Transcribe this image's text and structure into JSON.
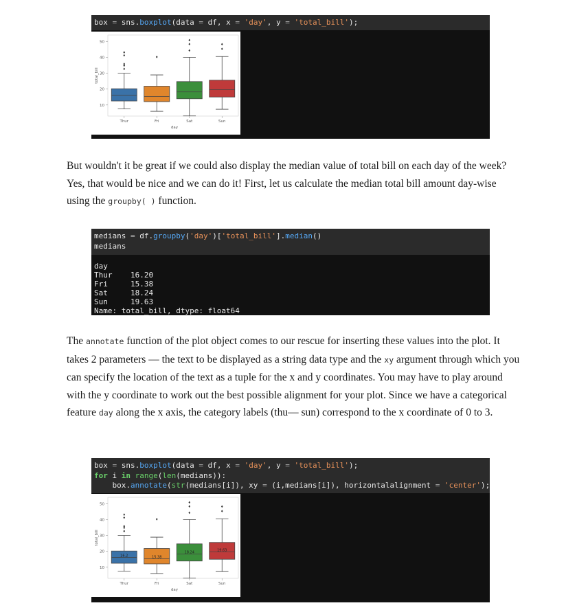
{
  "colors": {
    "thur": "#3a72a8",
    "fri": "#e0862c",
    "sat": "#3b8f3b",
    "sun": "#bf3a3a",
    "code_bg": "#111111",
    "code_header_bg": "#2b2b2b"
  },
  "block1": {
    "code_tokens": [
      [
        "box ",
        "k-var"
      ],
      [
        "=",
        "k-op"
      ],
      [
        " sns.",
        "k-var"
      ],
      [
        "boxplot",
        "k-fn"
      ],
      [
        "(data ",
        "k-var"
      ],
      [
        "=",
        "k-op"
      ],
      [
        " df, x ",
        "k-var"
      ],
      [
        "=",
        "k-op"
      ],
      [
        " ",
        "k-var"
      ],
      [
        "'day'",
        "k-str"
      ],
      [
        ", y ",
        "k-var"
      ],
      [
        "=",
        "k-op"
      ],
      [
        " ",
        "k-var"
      ],
      [
        "'total_bill'",
        "k-str"
      ],
      [
        ");",
        "k-var"
      ]
    ]
  },
  "para1": {
    "before": "But wouldn't it be great if we could also display the median value of total bill on each day of the week? Yes, that would be nice and we can do it! First, let us calculate the median total bill amount day-wise using the ",
    "code": "groupby( )",
    "after": " function."
  },
  "block2": {
    "line1": [
      [
        "medians ",
        "k-var"
      ],
      [
        "=",
        "k-op"
      ],
      [
        " df.",
        "k-var"
      ],
      [
        "groupby",
        "k-fn"
      ],
      [
        "(",
        "k-var"
      ],
      [
        "'day'",
        "k-str"
      ],
      [
        ")[",
        "k-var"
      ],
      [
        "'total_bill'",
        "k-str"
      ],
      [
        "].",
        "k-var"
      ],
      [
        "median",
        "k-fn"
      ],
      [
        "()",
        "k-var"
      ]
    ],
    "line2": "medians",
    "output": [
      "day",
      "Thur    16.20",
      "Fri     15.38",
      "Sat     18.24",
      "Sun     19.63",
      "Name: total_bill, dtype: float64"
    ]
  },
  "para2": {
    "segments": [
      [
        "The ",
        "t"
      ],
      [
        "annotate",
        "c"
      ],
      [
        " function of the plot object comes to our rescue for inserting these values into the plot. It takes 2 parameters — the text to be displayed as a string data type and the ",
        "t"
      ],
      [
        "xy",
        "c"
      ],
      [
        " argument through which you can specify the location of the text as a tuple for the x and y coordinates. You may have to play around with the y coordinate to work out the best possible alignment for your plot. Since we have a categorical feature ",
        "t"
      ],
      [
        "day",
        "c"
      ],
      [
        " along the x axis, the category labels (thu— sun) correspond to the x coordinate of 0 to 3.",
        "t"
      ]
    ]
  },
  "block3": {
    "lines": [
      [
        [
          "box ",
          "k-var"
        ],
        [
          "=",
          "k-op"
        ],
        [
          " sns.",
          "k-var"
        ],
        [
          "boxplot",
          "k-fn"
        ],
        [
          "(data ",
          "k-var"
        ],
        [
          "=",
          "k-op"
        ],
        [
          " df, x ",
          "k-var"
        ],
        [
          "=",
          "k-op"
        ],
        [
          " ",
          "k-var"
        ],
        [
          "'day'",
          "k-str"
        ],
        [
          ", y ",
          "k-var"
        ],
        [
          "=",
          "k-op"
        ],
        [
          " ",
          "k-var"
        ],
        [
          "'total_bill'",
          "k-str"
        ],
        [
          ");",
          "k-var"
        ]
      ],
      [
        [
          "for",
          "k-kw"
        ],
        [
          " i ",
          "k-var"
        ],
        [
          "in",
          "k-kw"
        ],
        [
          " ",
          "k-var"
        ],
        [
          "range",
          "k-blt"
        ],
        [
          "(",
          "k-var"
        ],
        [
          "len",
          "k-blt"
        ],
        [
          "(medians)):",
          "k-var"
        ]
      ],
      [
        [
          "    box.",
          "k-var"
        ],
        [
          "annotate",
          "k-fn"
        ],
        [
          "(",
          "k-var"
        ],
        [
          "str",
          "k-blt"
        ],
        [
          "(medians[i]), xy ",
          "k-var"
        ],
        [
          "=",
          "k-op"
        ],
        [
          " (i,medians[i]), horizontalalignment ",
          "k-var"
        ],
        [
          "=",
          "k-op"
        ],
        [
          " ",
          "k-var"
        ],
        [
          "'center'",
          "k-str"
        ],
        [
          ");",
          "k-var"
        ]
      ]
    ]
  },
  "chart_data": [
    {
      "type": "box",
      "xlabel": "day",
      "ylabel": "total_bill",
      "categories": [
        "Thur",
        "Fri",
        "Sat",
        "Sun"
      ],
      "ylim": [
        3,
        54
      ],
      "yticks": [
        10,
        20,
        30,
        40,
        50
      ],
      "boxes": [
        {
          "whisker_low": 7.5,
          "q1": 12.5,
          "median": 16.2,
          "q3": 20.2,
          "whisker_high": 30.0,
          "outliers": [
            32.7,
            34.8,
            35.8,
            41.2,
            43.1
          ]
        },
        {
          "whisker_low": 6.0,
          "q1": 12.1,
          "median": 15.38,
          "q3": 21.8,
          "whisker_high": 28.9,
          "outliers": [
            40.2
          ]
        },
        {
          "whisker_low": 3.1,
          "q1": 13.9,
          "median": 18.24,
          "q3": 24.7,
          "whisker_high": 40.0,
          "outliers": [
            44.3,
            48.3,
            50.8
          ]
        },
        {
          "whisker_low": 7.3,
          "q1": 15.0,
          "median": 19.63,
          "q3": 25.6,
          "whisker_high": 40.5,
          "outliers": [
            45.3,
            48.2
          ]
        }
      ],
      "annotations": []
    },
    {
      "type": "box",
      "xlabel": "day",
      "ylabel": "total_bill",
      "categories": [
        "Thur",
        "Fri",
        "Sat",
        "Sun"
      ],
      "ylim": [
        3,
        54
      ],
      "yticks": [
        10,
        20,
        30,
        40,
        50
      ],
      "boxes": [
        {
          "whisker_low": 7.5,
          "q1": 12.5,
          "median": 16.2,
          "q3": 20.2,
          "whisker_high": 30.0,
          "outliers": [
            32.7,
            34.8,
            35.8,
            41.2,
            43.1
          ]
        },
        {
          "whisker_low": 6.0,
          "q1": 12.1,
          "median": 15.38,
          "q3": 21.8,
          "whisker_high": 28.9,
          "outliers": [
            40.2
          ]
        },
        {
          "whisker_low": 3.1,
          "q1": 13.9,
          "median": 18.24,
          "q3": 24.7,
          "whisker_high": 40.0,
          "outliers": [
            44.3,
            48.3,
            50.8
          ]
        },
        {
          "whisker_low": 7.3,
          "q1": 15.0,
          "median": 19.63,
          "q3": 25.6,
          "whisker_high": 40.5,
          "outliers": [
            45.3,
            48.2
          ]
        }
      ],
      "annotations": [
        "16.2",
        "15.38",
        "18.24",
        "19.63"
      ]
    }
  ]
}
